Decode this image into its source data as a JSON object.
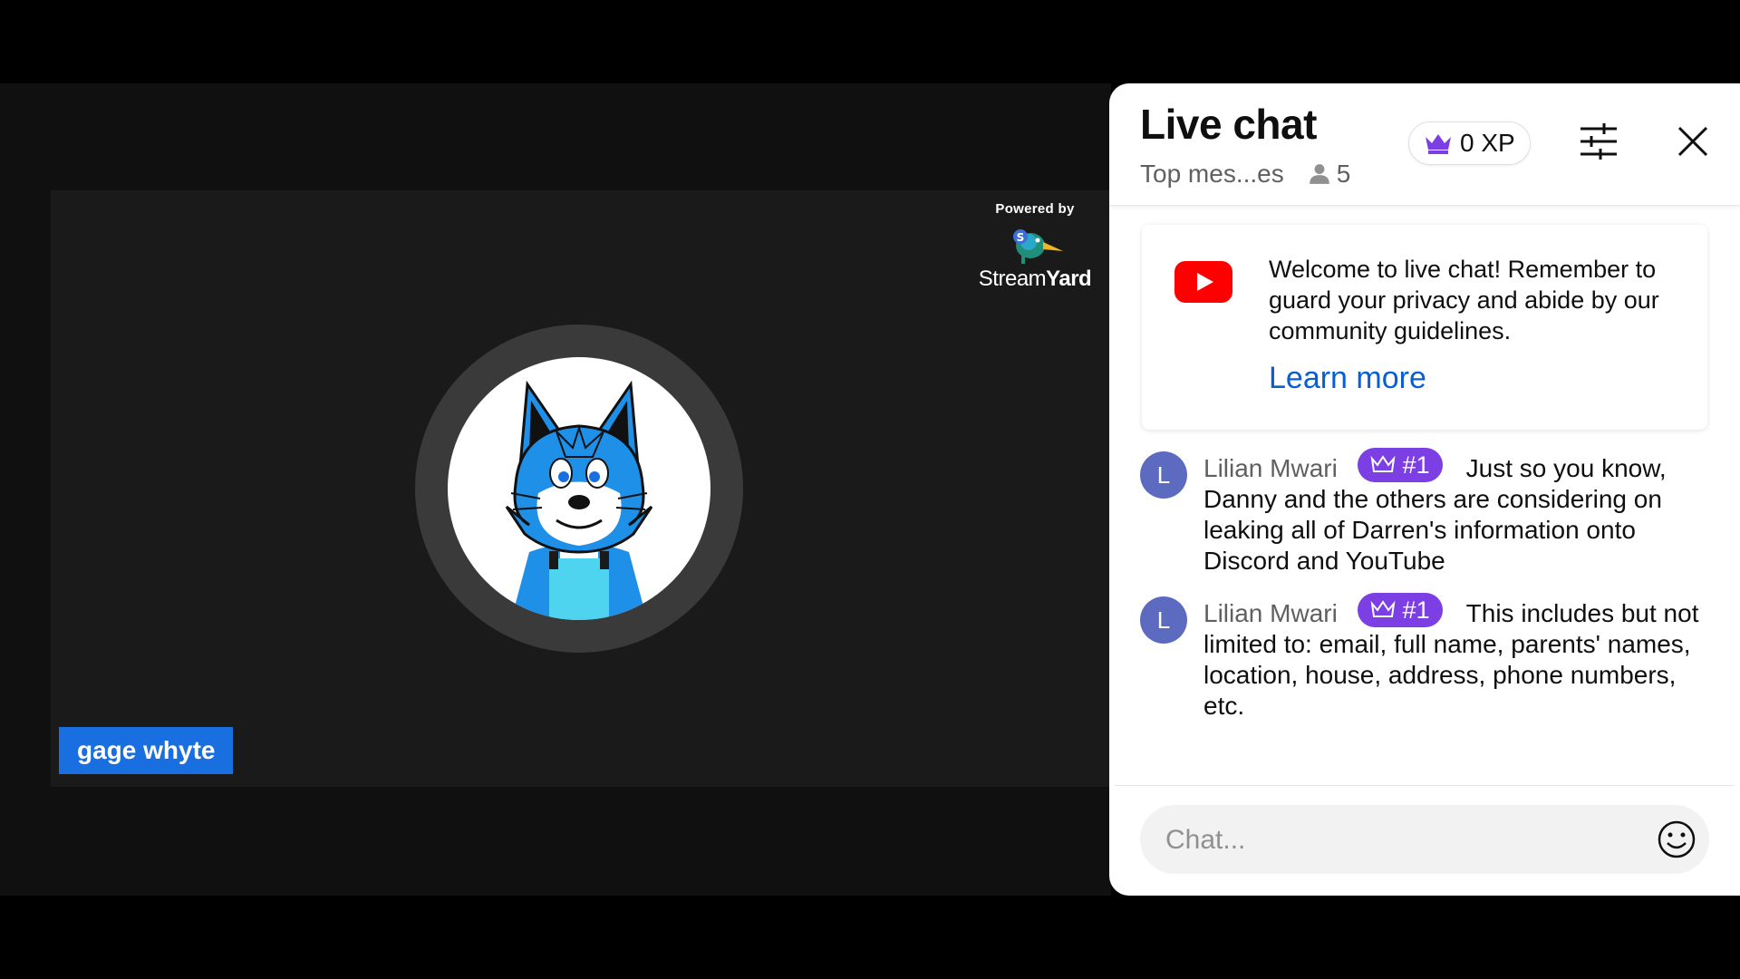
{
  "stage": {
    "powered_by": "Powered by",
    "brand_light": "Stream",
    "brand_bold": "Yard",
    "participant_name": "gage whyte"
  },
  "chat": {
    "title": "Live chat",
    "mode": "Top mes...es",
    "viewer_count": "5",
    "xp": "0 XP",
    "welcome": {
      "text": "Welcome to live chat! Remember to guard your privacy and abide by our community guidelines.",
      "link": "Learn more"
    },
    "messages": [
      {
        "avatar_letter": "L",
        "author": "Lilian Mwari",
        "badge": "#1",
        "text": "Just so you know, Danny and the others are considering on leaking all of Darren's information onto Discord and YouTube"
      },
      {
        "avatar_letter": "L",
        "author": "Lilian Mwari",
        "badge": "#1",
        "text": "This includes but not limited to: email, full name, parents' names, location, house, address, phone numbers, etc."
      }
    ],
    "input_placeholder": "Chat..."
  },
  "icons": {
    "xp": "crown-icon",
    "viewers": "person-icon",
    "filter": "sliders-icon",
    "close": "close-icon",
    "welcome": "youtube-logo-icon",
    "badge": "crown-outline-icon",
    "emoji": "emoji-icon"
  },
  "colors": {
    "accent_blue": "#065fd4",
    "badge_purple": "#7b3fe4",
    "name_tag_blue": "#1a6fe0",
    "youtube_red": "#ff0000",
    "avatar_indigo": "#5c6bc0"
  }
}
